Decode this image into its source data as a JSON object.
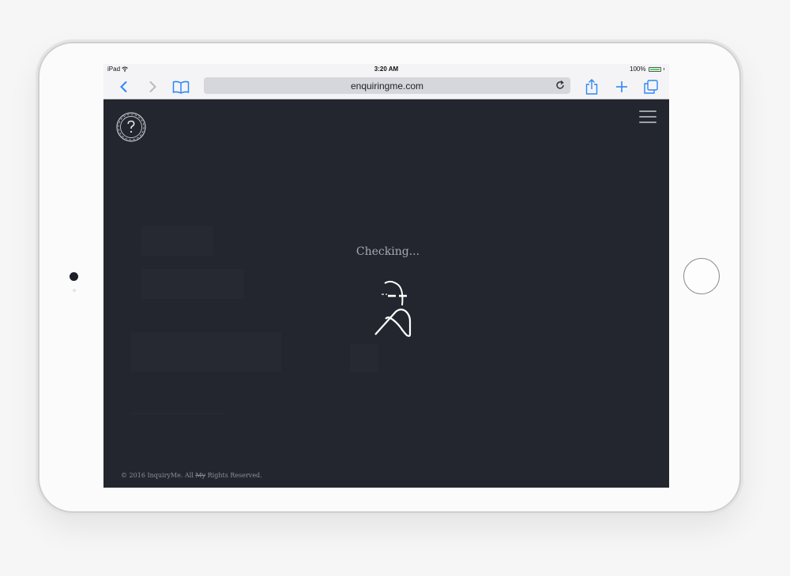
{
  "status_bar": {
    "device": "iPad",
    "wifi_icon": "wifi-icon",
    "time": "3:20 AM",
    "battery": "100%"
  },
  "browser": {
    "url": "enquiringme.com",
    "icons": {
      "back": "chevron-left-icon",
      "forward": "chevron-right-icon",
      "bookmarks": "book-icon",
      "reload": "reload-icon",
      "share": "share-icon",
      "new_tab": "plus-icon",
      "tabs": "tabs-icon"
    }
  },
  "page": {
    "logo_icon": "question-mark-logo",
    "menu_icon": "hamburger-menu-icon",
    "loading_text": "Checking...",
    "loading_figure": "thinking-character-icon",
    "footer": {
      "prefix": "© 2016 InquiryMe. All ",
      "struck": "My",
      "suffix": " Rights Reserved."
    }
  },
  "colors": {
    "page_background": "#23262f",
    "browser_accent": "#2f87f5",
    "battery": "#4cd964"
  }
}
